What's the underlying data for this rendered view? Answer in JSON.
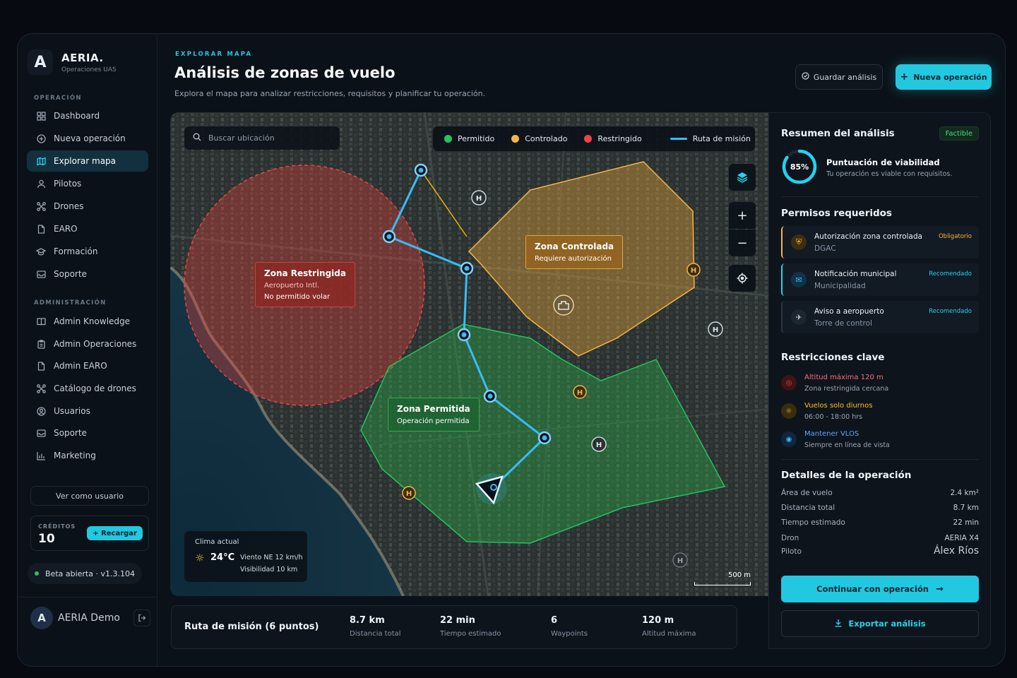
{
  "brand": {
    "logo_letter": "A",
    "name": "AERIA.",
    "subtitle": "Operaciones UAS"
  },
  "sidebar": {
    "section_operation": "OPERACIÓN",
    "items_operation": [
      {
        "label": "Dashboard",
        "icon": "grid-icon"
      },
      {
        "label": "Nueva operación",
        "icon": "plus-circle-icon"
      },
      {
        "label": "Explorar mapa",
        "icon": "map-icon",
        "active": true
      },
      {
        "label": "Pilotos",
        "icon": "user-icon"
      },
      {
        "label": "Drones",
        "icon": "drone-icon"
      },
      {
        "label": "EARO",
        "icon": "document-icon"
      },
      {
        "label": "Formación",
        "icon": "graduation-cap-icon"
      },
      {
        "label": "Soporte",
        "icon": "inbox-icon"
      }
    ],
    "section_admin": "ADMINISTRACIÓN",
    "items_admin": [
      {
        "label": "Admin Knowledge",
        "icon": "book-icon"
      },
      {
        "label": "Admin Operaciones",
        "icon": "clipboard-icon"
      },
      {
        "label": "Admin EARO",
        "icon": "document-icon"
      },
      {
        "label": "Catálogo de drones",
        "icon": "drone-icon"
      },
      {
        "label": "Usuarios",
        "icon": "user-circle-icon"
      },
      {
        "label": "Soporte",
        "icon": "inbox-icon"
      },
      {
        "label": "Marketing",
        "icon": "bar-chart-icon"
      }
    ],
    "view_as_user": "Ver como usuario",
    "credits_label": "CRÉDITOS",
    "credits_value": "10",
    "recharge_label": "+ Recargar",
    "beta_label": "Beta abierta · v1.3.104",
    "user_initial": "A",
    "user_name": "AERIA Demo"
  },
  "header": {
    "eyebrow": "EXPLORAR MAPA",
    "title": "Análisis de zonas de vuelo",
    "subtitle": "Explora el mapa para analizar restricciones, requisitos y planificar tu operación.",
    "save_label": "Guardar análisis",
    "new_label": "Nueva operación"
  },
  "map": {
    "search_placeholder": "Buscar ubicación",
    "legend": {
      "allowed": "Permitido",
      "controlled": "Controlado",
      "restricted": "Restringido",
      "route": "Ruta de misión"
    },
    "colors": {
      "allowed": "#22c55e",
      "controlled": "#f5b544",
      "restricted": "#ef4444",
      "route": "#38bdf8"
    },
    "zones": {
      "restricted": {
        "title": "Zona Restringida",
        "line1": "Aeropuerto Intl.",
        "line2": "No permitido volar"
      },
      "controlled": {
        "title": "Zona Controlada",
        "line1": "Requiere autorización"
      },
      "allowed": {
        "title": "Zona Permitida",
        "line1": "Operación permitida"
      }
    },
    "weather": {
      "label": "Clima actual",
      "temp": "24°C",
      "wind": "Viento NE 12 km/h",
      "visibility": "Visibilidad 10 km"
    },
    "scale": "500 m"
  },
  "mission": {
    "title": "Ruta de misión (6 puntos)",
    "stats": [
      {
        "value": "8.7 km",
        "label": "Distancia total"
      },
      {
        "value": "22 min",
        "label": "Tiempo estimado"
      },
      {
        "value": "6",
        "label": "Waypoints"
      },
      {
        "value": "120 m",
        "label": "Altitud máxima"
      }
    ]
  },
  "panel": {
    "summary_title": "Resumen del análisis",
    "feasible_badge": "Factible",
    "score_percent": 85,
    "score_label": "85%",
    "score_title": "Puntuación de viabilidad",
    "score_sub": "Tu operación es viable con requisitos.",
    "permits_title": "Permisos requeridos",
    "permits": [
      {
        "title": "Autorización zona controlada",
        "sub": "DGAC",
        "tag": "Obligatorio",
        "icon": "shield-icon"
      },
      {
        "title": "Notificación municipal",
        "sub": "Municipalidad",
        "tag": "Recomendado",
        "icon": "mail-icon"
      },
      {
        "title": "Aviso a aeropuerto",
        "sub": "Torre de control",
        "tag": "Recomendado",
        "icon": "plane-icon"
      }
    ],
    "restrictions_title": "Restricciones clave",
    "restrictions": [
      {
        "title": "Altitud máxima 120 m",
        "sub": "Zona restringida cercana",
        "icon": "altitude-icon"
      },
      {
        "title": "Vuelos solo diurnos",
        "sub": "06:00 - 18:00 hrs",
        "icon": "sun-icon"
      },
      {
        "title": "Mantener VLOS",
        "sub": "Siempre en línea de vista",
        "icon": "eye-icon"
      }
    ],
    "details_title": "Detalles de la operación",
    "details": [
      {
        "label": "Área de vuelo",
        "value": "2.4 km²"
      },
      {
        "label": "Distancia total",
        "value": "8.7 km"
      },
      {
        "label": "Tiempo estimado",
        "value": "22 min"
      },
      {
        "label": "Dron",
        "value": "AERIA X4"
      },
      {
        "label": "Piloto",
        "value": "Álex Ríos"
      }
    ],
    "continue_label": "Continuar con operación",
    "export_label": "Exportar análisis"
  }
}
